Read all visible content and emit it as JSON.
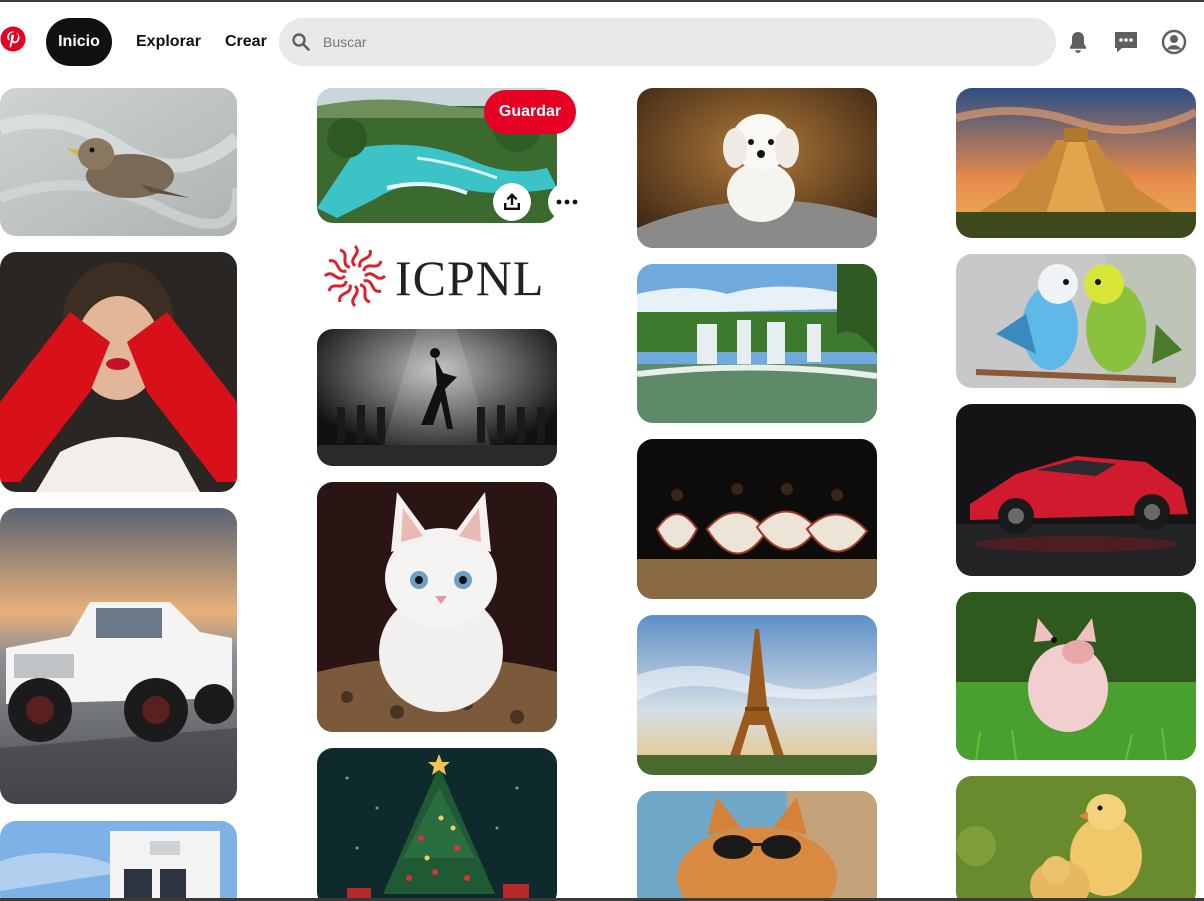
{
  "header": {
    "logo_icon": "pinterest-logo-icon",
    "nav": {
      "home": "Inicio",
      "explore": "Explorar",
      "create": "Crear"
    },
    "search": {
      "placeholder": "Buscar",
      "value": ""
    },
    "icons": [
      "bell-icon",
      "messages-icon",
      "user-profile-icon"
    ]
  },
  "hover_pin": {
    "save_label": "Guardar",
    "share_icon": "share-upload-icon",
    "more_icon": "more-options-icon"
  },
  "brand_pin": {
    "text": "ICPNL"
  },
  "colors": {
    "brand": "#e60023",
    "nav_active": "#111111",
    "search_bg": "#e9e9e9"
  },
  "pins": {
    "col1": [
      "sparrow-chick",
      "girl-red-gloves",
      "white-pickup-truck",
      "modern-house"
    ],
    "col2": [
      "turquoise-waterfalls",
      "dancer-spotlight",
      "white-kitten",
      "christmas-tree"
    ],
    "col3": [
      "white-puppy",
      "iguazu-falls",
      "folk-dancers",
      "eiffel-tower",
      "cat-sunglasses"
    ],
    "col4": [
      "chichen-itza-pyramid",
      "budgie-parrots",
      "red-sports-car",
      "piglet-grass",
      "baby-chicks"
    ]
  }
}
